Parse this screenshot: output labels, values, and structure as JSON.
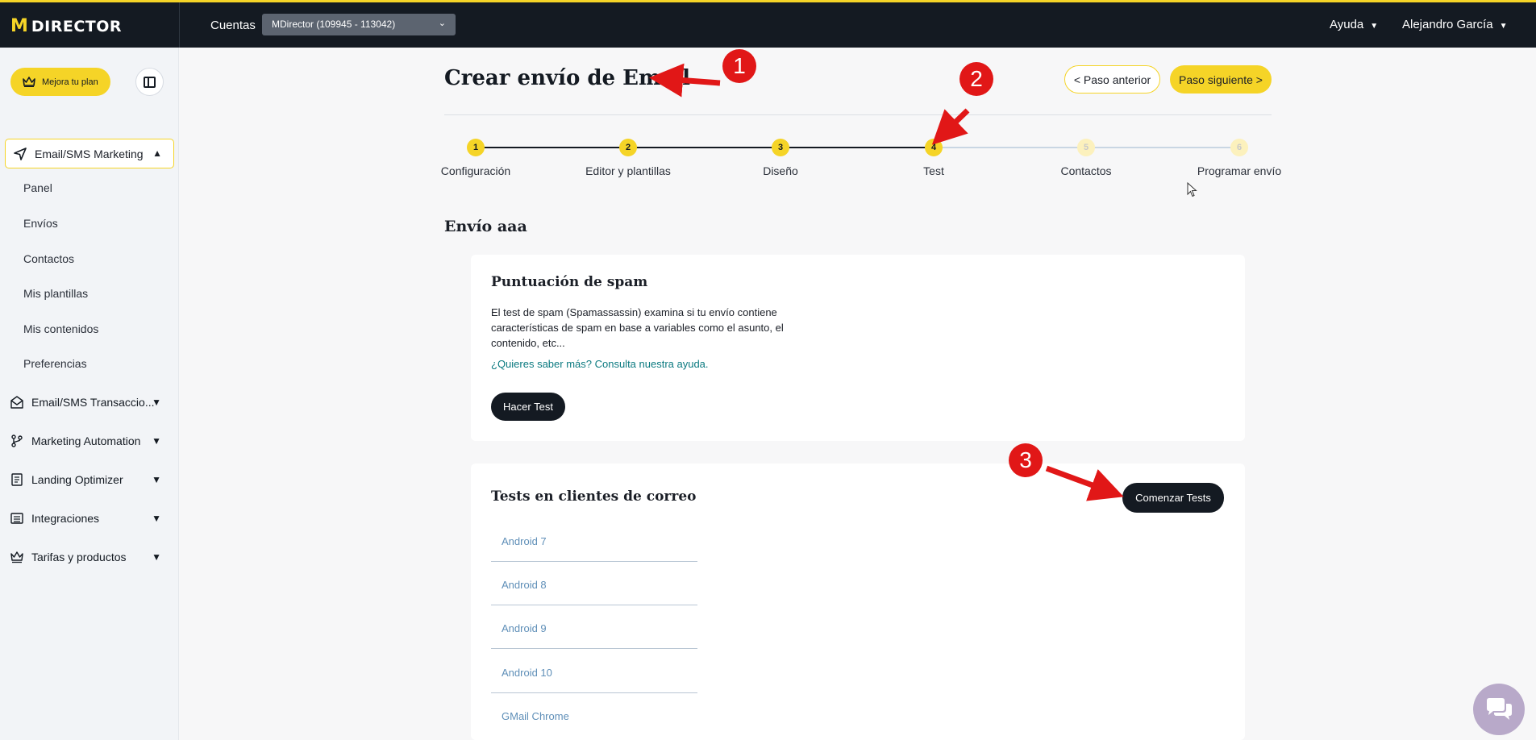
{
  "topbar": {
    "logo_text": "DIRECTOR",
    "cuentas_label": "Cuentas",
    "account_value": "MDirector (109945 - 113042)",
    "help_label": "Ayuda",
    "user_name": "Alejandro García"
  },
  "sidebar": {
    "upgrade_label": "Mejora tu plan",
    "active_section": "Email/SMS Marketing",
    "sub_items": [
      "Panel",
      "Envíos",
      "Contactos",
      "Mis plantillas",
      "Mis contenidos",
      "Preferencias"
    ],
    "sections": [
      "Email/SMS Transaccio...",
      "Marketing Automation",
      "Landing Optimizer",
      "Integraciones",
      "Tarifas y productos"
    ]
  },
  "main": {
    "title": "Crear envío de Email",
    "prev_button": "< Paso anterior",
    "next_button": "Paso siguiente >",
    "steps": [
      {
        "number": "1",
        "label": "Configuración",
        "state": "done"
      },
      {
        "number": "2",
        "label": "Editor y plantillas",
        "state": "done"
      },
      {
        "number": "3",
        "label": "Diseño",
        "state": "done"
      },
      {
        "number": "4",
        "label": "Test",
        "state": "current"
      },
      {
        "number": "5",
        "label": "Contactos",
        "state": "todo"
      },
      {
        "number": "6",
        "label": "Programar envío",
        "state": "todo"
      }
    ],
    "send_name": "Envío aaa",
    "spam_card": {
      "title": "Puntuación de spam",
      "description": "El test de spam (Spamassassin) examina si tu envío contiene características de spam en base a variables como el asunto, el contenido, etc...",
      "help_link": "¿Quieres saber más? Consulta nuestra ayuda.",
      "button": "Hacer Test"
    },
    "clients_card": {
      "title": "Tests en clientes de correo",
      "button": "Comenzar Tests",
      "clients": [
        "Android 7",
        "Android 8",
        "Android 9",
        "Android 10",
        "GMail Chrome"
      ]
    }
  },
  "annotations": [
    "1",
    "2",
    "3"
  ],
  "colors": {
    "accent": "#f5d427",
    "topbar": "#141a22",
    "annotation": "#e11717",
    "link": "#0b7a80"
  }
}
